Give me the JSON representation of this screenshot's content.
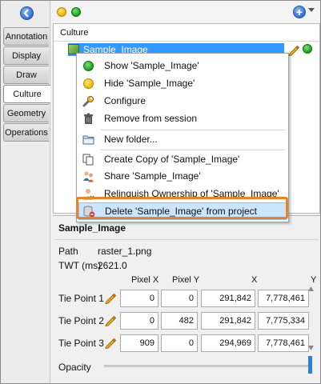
{
  "tabs": [
    "Annotation",
    "Display",
    "Draw",
    "Culture",
    "Geometry",
    "Operations"
  ],
  "active_tab": "Culture",
  "tree": {
    "header": "Culture",
    "item_label": "Sample_Image"
  },
  "context_menu": {
    "items": [
      {
        "label": "Show 'Sample_Image'",
        "icon": "green-dot-icon"
      },
      {
        "label": "Hide 'Sample_Image'",
        "icon": "yellow-dot-icon"
      },
      {
        "label": "Configure",
        "icon": "wrench-icon"
      },
      {
        "label": "Remove from session",
        "icon": "trash-icon"
      },
      {
        "label": "New folder...",
        "icon": "folder-icon"
      },
      {
        "label": "Create Copy of 'Sample_Image'",
        "icon": "copy-icon"
      },
      {
        "label": "Share 'Sample_Image'",
        "icon": "share-users-icon"
      },
      {
        "label": "Relinquish Ownership of 'Sample_Image'",
        "icon": "relinquish-user-icon"
      },
      {
        "label": "Delete 'Sample_Image' from project",
        "icon": "delete-db-icon"
      }
    ]
  },
  "properties": {
    "title": "Sample_Image",
    "path_key": "Path",
    "path_value": "raster_1.png",
    "twt_key": "TWT (ms)",
    "twt_value": "2621.0",
    "columns": [
      "Pixel X",
      "Pixel Y",
      "X",
      "Y"
    ],
    "tie_points": [
      {
        "label": "Tie Point 1",
        "px": "0",
        "py": "0",
        "x": "291,842",
        "y": "7,778,461"
      },
      {
        "label": "Tie Point 2",
        "px": "0",
        "py": "482",
        "x": "291,842",
        "y": "7,775,334"
      },
      {
        "label": "Tie Point 3",
        "px": "909",
        "py": "0",
        "x": "294,969",
        "y": "7,778,461"
      }
    ],
    "opacity_label": "Opacity",
    "opacity": 1.0
  },
  "colors": {
    "selection": "#3399ff",
    "highlight_frame": "#e8832a",
    "opacity_thumb": "#2c7fe0"
  }
}
